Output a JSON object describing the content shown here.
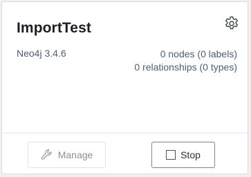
{
  "card": {
    "title": "ImportTest",
    "version": "Neo4j 3.4.6",
    "nodes_text": "0 nodes (0 labels)",
    "relationships_text": "0 relationships (0 types)"
  },
  "icons": {
    "settings": "gear-icon",
    "manage": "wrench-icon",
    "stop": "stop-square-icon"
  },
  "actions": {
    "manage_label": "Manage",
    "stop_label": "Stop"
  },
  "colors": {
    "title": "#1b1f24",
    "meta_text": "#4a5f7a",
    "disabled_text": "#8a8f96"
  }
}
